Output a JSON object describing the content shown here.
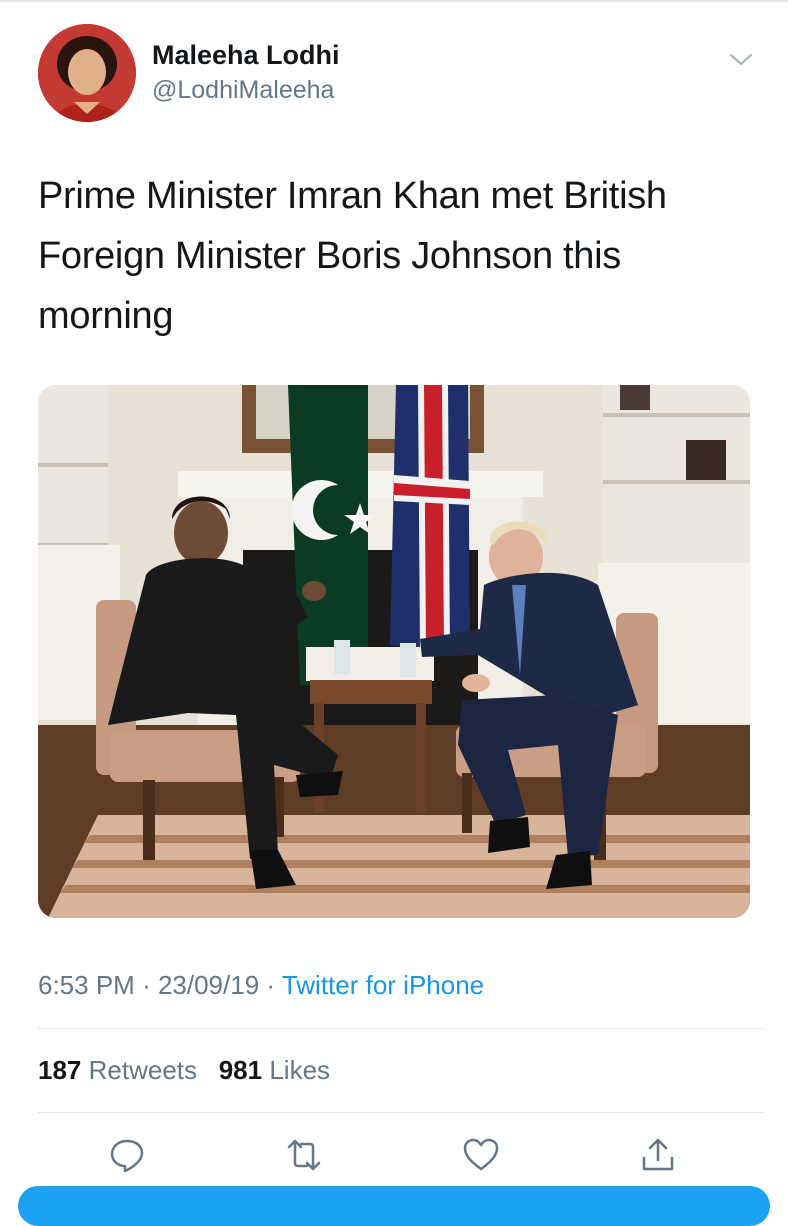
{
  "author": {
    "name": "Maleeha Lodhi",
    "handle": "@LodhiMaleeha"
  },
  "tweet": {
    "text": "Prime Minister Imran Khan met British Foreign Minister Boris Johnson this morning",
    "time": "6:53 PM",
    "date": "23/09/19",
    "source": "Twitter for iPhone"
  },
  "stats": {
    "retweets_count": "187",
    "retweets_label": "Retweets",
    "likes_count": "981",
    "likes_label": "Likes"
  },
  "actions": [
    {
      "icon": "reply-icon"
    },
    {
      "icon": "retweet-icon"
    },
    {
      "icon": "like-icon"
    },
    {
      "icon": "share-icon"
    }
  ],
  "colors": {
    "accent": "#1da1f2",
    "link": "#1b95e0",
    "secondary_text": "#657786",
    "primary_text": "#14171a",
    "divider": "#e1e8ed"
  }
}
